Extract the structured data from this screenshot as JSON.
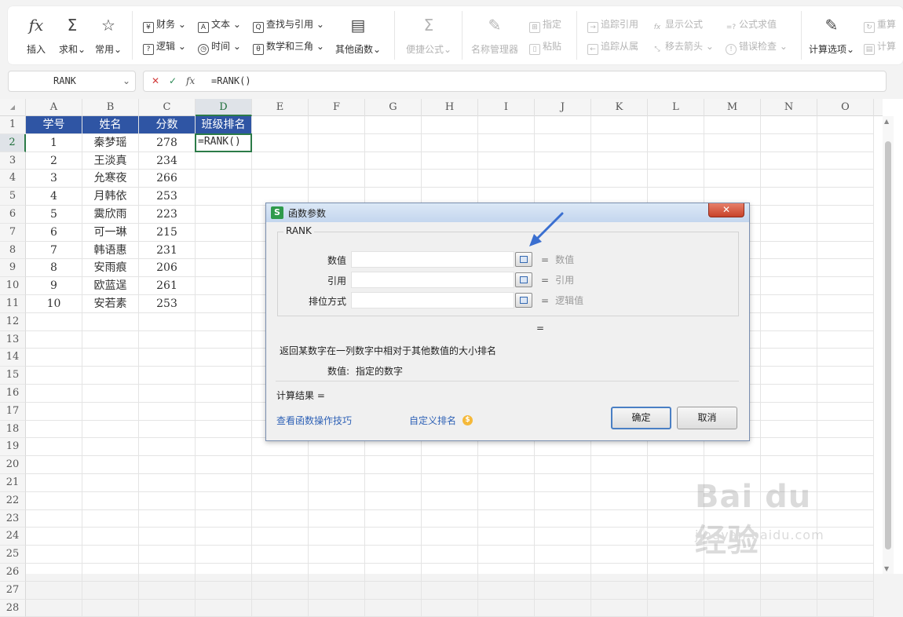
{
  "ribbon": {
    "insert_fn": "插入",
    "autosum": "求和",
    "common": "常用",
    "finance": "财务",
    "logic": "逻辑",
    "text": "文本",
    "time": "时间",
    "lookup": "查找与引用",
    "math": "数学和三角",
    "other_fns": "其他函数",
    "quick_formula": "便捷公式",
    "name_manager": "名称管理器",
    "define": "指定",
    "paste": "粘贴",
    "trace_precedents": "追踪引用",
    "trace_dependents": "追踪从属",
    "show_formulas": "显示公式",
    "remove_arrows": "移去箭头",
    "evaluate_formula": "公式求值",
    "error_checking": "错误检查",
    "calc_options": "计算选项",
    "recalc": "重算",
    "calc_sheet": "计算"
  },
  "formula_bar": {
    "name_box": "RANK",
    "cancel_glyph": "✕",
    "confirm_glyph": "✓",
    "fx_glyph": "fx",
    "content": "=RANK()"
  },
  "sheet": {
    "columns": [
      "A",
      "B",
      "C",
      "D",
      "E",
      "F",
      "G",
      "H",
      "I",
      "J",
      "K",
      "L",
      "M",
      "N",
      "O"
    ],
    "rows": [
      "1",
      "2",
      "3",
      "4",
      "5",
      "6",
      "7",
      "8",
      "9",
      "10",
      "11",
      "12",
      "13",
      "14",
      "15",
      "16",
      "17",
      "18",
      "19",
      "20",
      "21",
      "22",
      "23",
      "24",
      "25",
      "26",
      "27",
      "28"
    ],
    "headers": [
      "学号",
      "姓名",
      "分数",
      "班级排名"
    ],
    "data": [
      [
        "1",
        "秦梦瑶",
        "278"
      ],
      [
        "2",
        "王淡真",
        "234"
      ],
      [
        "3",
        "允寒夜",
        "266"
      ],
      [
        "4",
        "月韩依",
        "253"
      ],
      [
        "5",
        "霙欣雨",
        "223"
      ],
      [
        "6",
        "可一琳",
        "215"
      ],
      [
        "7",
        "韩语惠",
        "231"
      ],
      [
        "8",
        "安雨痕",
        "206"
      ],
      [
        "9",
        "欧蓝逞",
        "261"
      ],
      [
        "10",
        "安若素",
        "253"
      ]
    ],
    "active_cell_value": "=RANK()",
    "header_color": "#2f55a4",
    "active_color": "#2c7b48"
  },
  "dialog": {
    "title": "函数参数",
    "app_icon": "S",
    "close_glyph": "✕",
    "function_name": "RANK",
    "args": [
      {
        "label": "数值",
        "hint": "数值"
      },
      {
        "label": "引用",
        "hint": "引用"
      },
      {
        "label": "排位方式",
        "hint": "逻辑值"
      }
    ],
    "equals": "=",
    "description": "返回某数字在一列数字中相对于其他数值的大小排名",
    "arg_desc_name": "数值:",
    "arg_desc_text": "指定的数字",
    "result_label": "计算结果  =",
    "link_tips": "查看函数操作技巧",
    "link_custom": "自定义排名",
    "ok": "确定",
    "cancel": "取消"
  },
  "watermark": {
    "brand": "Bai du 经验",
    "url": "jingyan.baidu.com"
  }
}
